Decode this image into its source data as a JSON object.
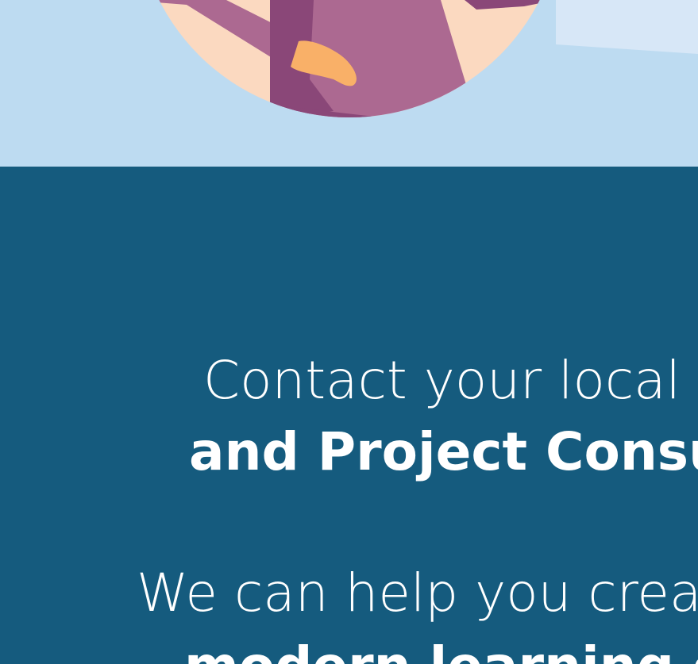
{
  "hero": {
    "illustration": "person-holding-baby-illustration"
  },
  "contact_section": {
    "line1": "Contact your local",
    "line2": "and Project Consul",
    "line3": "We can help you crea",
    "line4": "modern learning en"
  },
  "colors": {
    "hero_bg": "#bddbf1",
    "section_bg": "#155b7e",
    "text": "#ffffff",
    "skin": "#fbd9c0",
    "sweater_light": "#ac6991",
    "sweater_dark": "#8a4778",
    "baby_skin": "#f9b068"
  }
}
